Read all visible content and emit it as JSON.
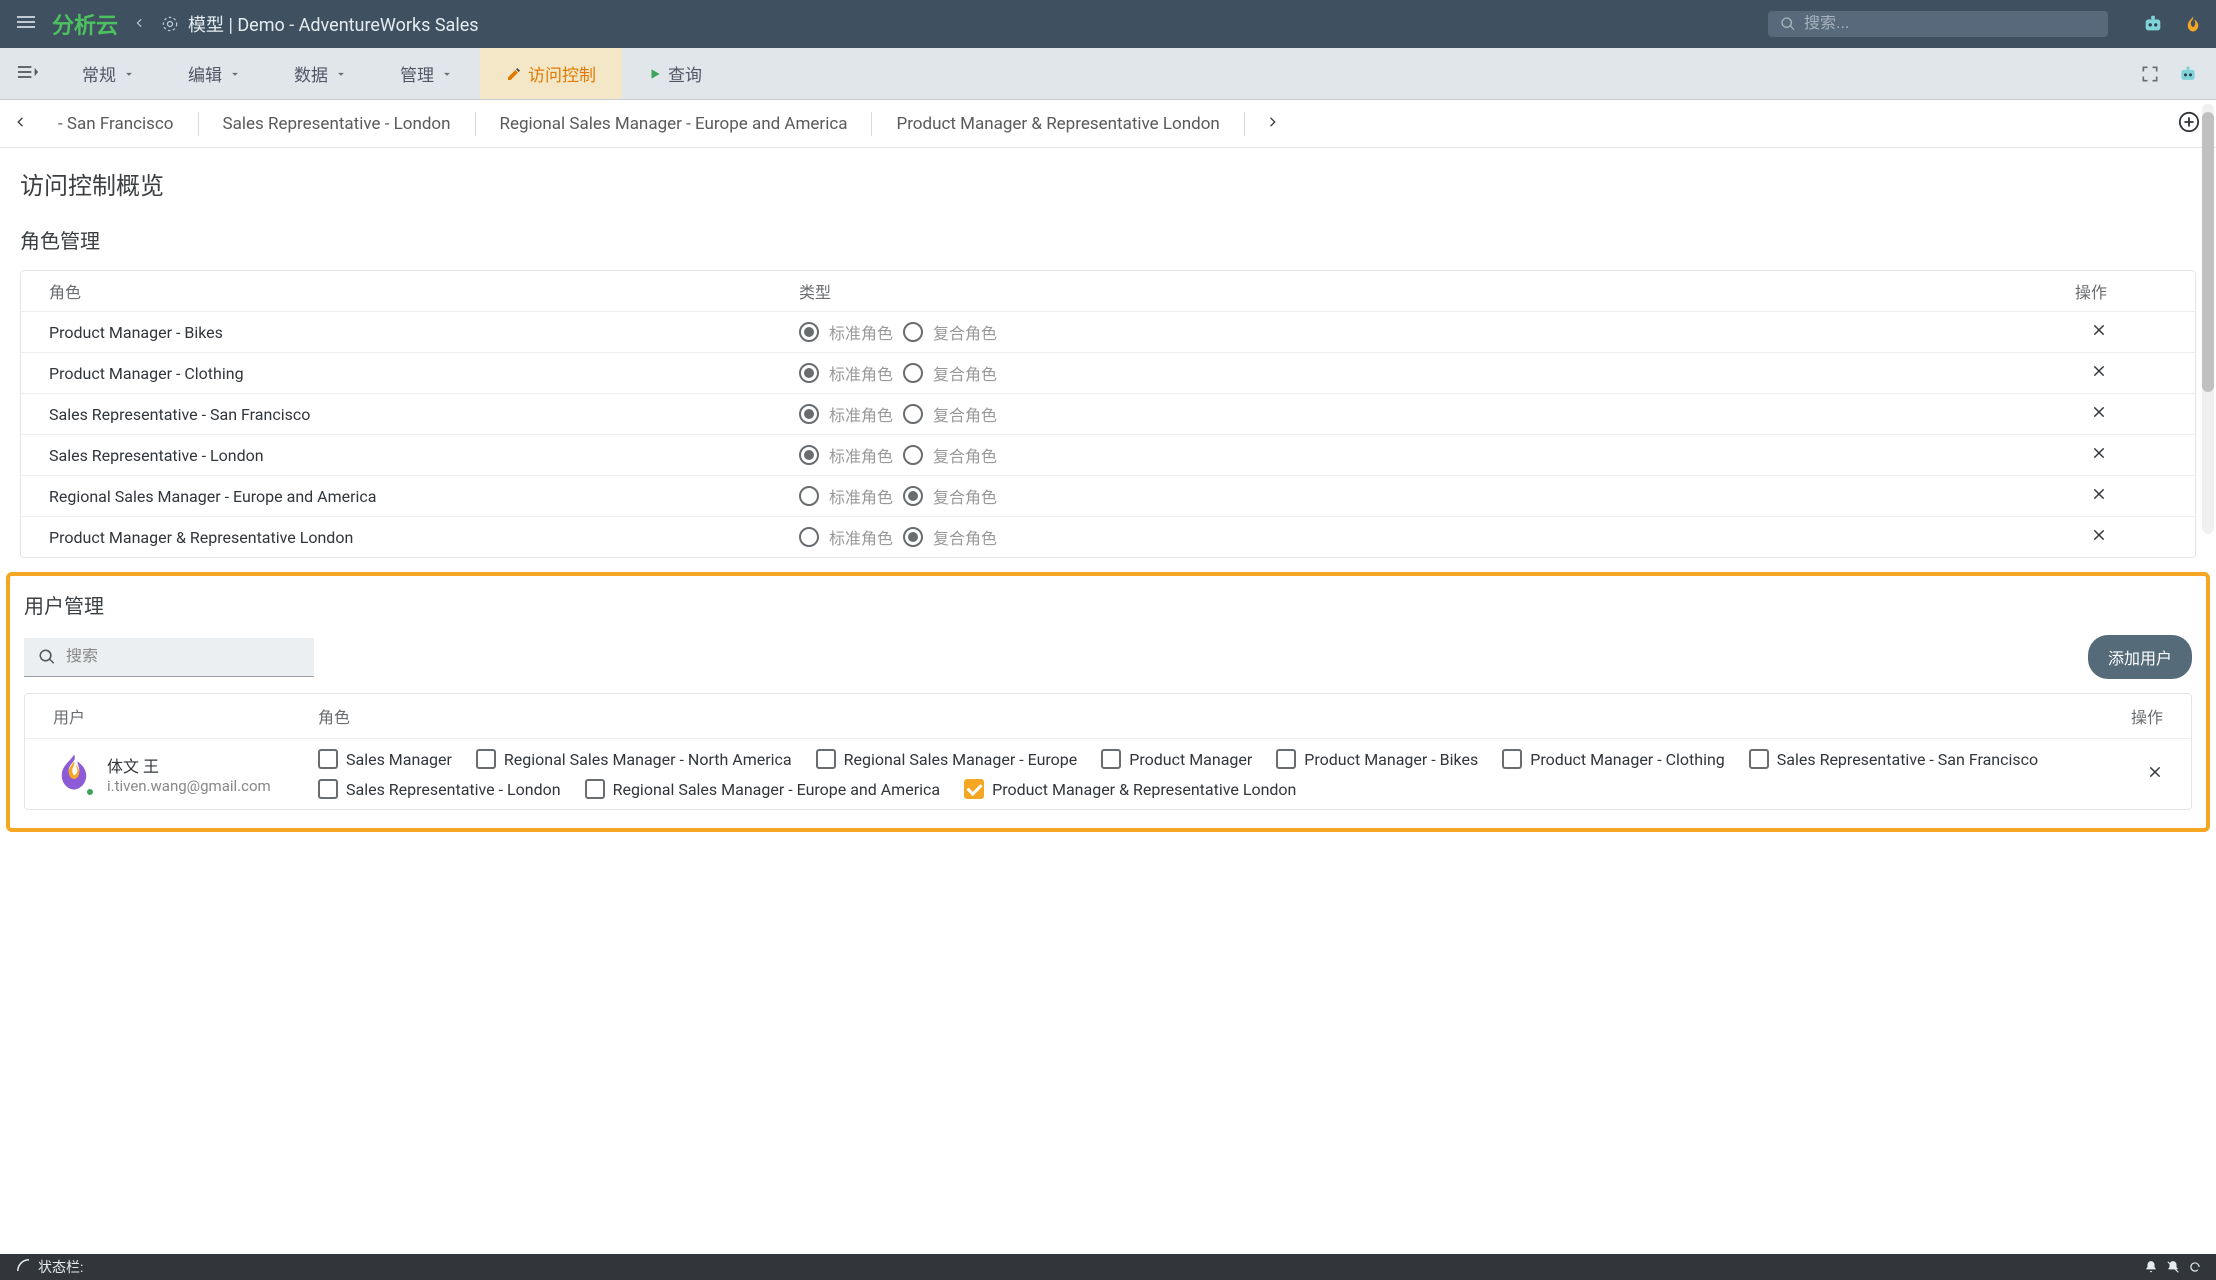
{
  "header": {
    "logo": "分析云",
    "breadcrumb_prefix": "模型",
    "breadcrumb_title": "Demo - AdventureWorks Sales",
    "search_placeholder": "搜索..."
  },
  "menu": {
    "items": [
      {
        "label": "常规",
        "type": "dropdown"
      },
      {
        "label": "编辑",
        "type": "dropdown"
      },
      {
        "label": "数据",
        "type": "dropdown"
      },
      {
        "label": "管理",
        "type": "dropdown"
      },
      {
        "label": "访问控制",
        "type": "active"
      },
      {
        "label": "查询",
        "type": "action"
      }
    ]
  },
  "tabs": [
    "- San Francisco",
    "Sales Representative - London",
    "Regional Sales Manager - Europe and America",
    "Product Manager & Representative London"
  ],
  "page": {
    "title": "访问控制概览",
    "role_section_title": "角色管理",
    "user_section_title": "用户管理",
    "user_search_placeholder": "搜索",
    "add_user_label": "添加用户"
  },
  "role_table": {
    "headers": {
      "role": "角色",
      "type": "类型",
      "action": "操作"
    },
    "type_labels": {
      "standard": "标准角色",
      "composite": "复合角色"
    },
    "rows": [
      {
        "name": "Product Manager - Bikes",
        "selected": "standard"
      },
      {
        "name": "Product Manager - Clothing",
        "selected": "standard"
      },
      {
        "name": "Sales Representative - San Francisco",
        "selected": "standard"
      },
      {
        "name": "Sales Representative - London",
        "selected": "standard"
      },
      {
        "name": "Regional Sales Manager - Europe and America",
        "selected": "composite"
      },
      {
        "name": "Product Manager & Representative London",
        "selected": "composite"
      }
    ]
  },
  "user_table": {
    "headers": {
      "user": "用户",
      "role": "角色",
      "action": "操作"
    },
    "user": {
      "name": "体文 王",
      "email": "i.tiven.wang@gmail.com"
    },
    "role_options": [
      {
        "label": "Sales Manager",
        "checked": false
      },
      {
        "label": "Regional Sales Manager - North America",
        "checked": false
      },
      {
        "label": "Regional Sales Manager - Europe",
        "checked": false
      },
      {
        "label": "Product Manager",
        "checked": false
      },
      {
        "label": "Product Manager - Bikes",
        "checked": false
      },
      {
        "label": "Product Manager - Clothing",
        "checked": false
      },
      {
        "label": "Sales Representative - San Francisco",
        "checked": false
      },
      {
        "label": "Sales Representative - London",
        "checked": false
      },
      {
        "label": "Regional Sales Manager - Europe and America",
        "checked": false
      },
      {
        "label": "Product Manager & Representative London",
        "checked": true
      }
    ]
  },
  "status_bar": {
    "label": "状态栏:"
  }
}
